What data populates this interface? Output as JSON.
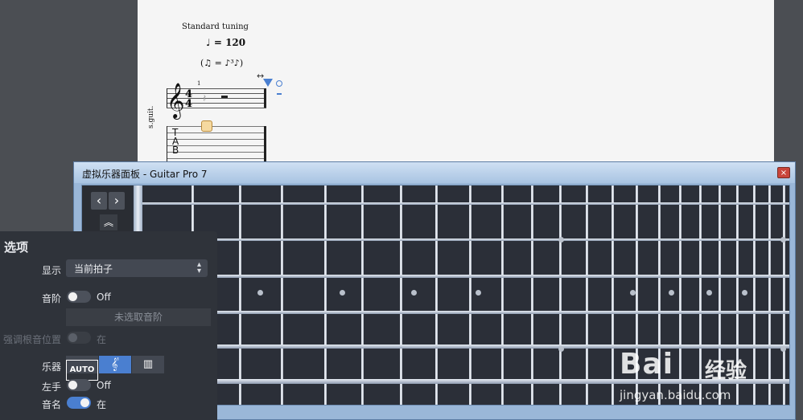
{
  "score": {
    "tuning": "Standard tuning",
    "tempo": "♩ = 120",
    "swing": "(♫ = ♪³♪)",
    "bar_number": "1",
    "track_label": "s.guit.",
    "tab_letters": "T\nA\nB"
  },
  "window": {
    "title": "虚拟乐器面板 - Guitar Pro 7",
    "close_label": "×"
  },
  "fretboard": {
    "nav_prev": "‹",
    "nav_next": "›",
    "nav_collapse": "︽"
  },
  "options": {
    "title": "选项",
    "display_label": "显示",
    "display_value": "当前拍子",
    "scale_label": "音阶",
    "scale_value": "Off",
    "scale_button": "未选取音阶",
    "root_label": "强调根音位置",
    "root_value": "在",
    "instrument_label": "乐器",
    "instrument_auto": "AUTO",
    "left_hand_label": "左手",
    "left_hand_value": "Off",
    "note_name_label": "音名",
    "note_name_value": "在"
  },
  "watermark": {
    "brand": "Bai",
    "brand2": "经验",
    "url": "jingyan.baidu.com"
  },
  "colors": {
    "accent": "#4a7fd0",
    "panel": "#2f333a",
    "fretboard": "#2b2f38"
  }
}
